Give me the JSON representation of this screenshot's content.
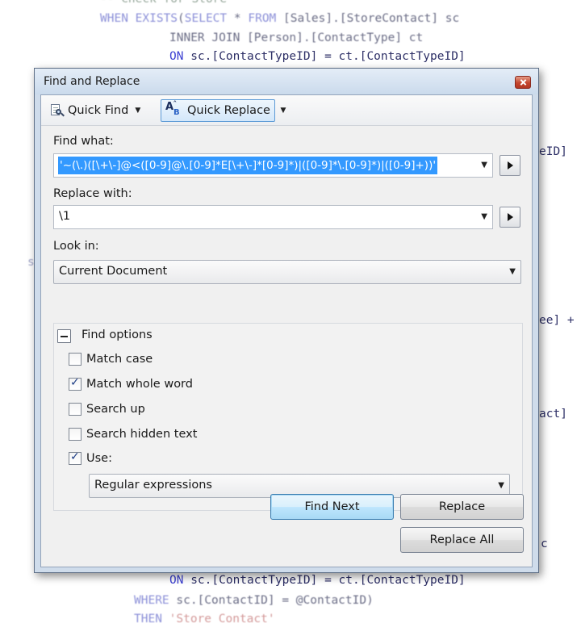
{
  "editor": {
    "lines": [
      {
        "indent": "        ",
        "parts": [
          {
            "t": "-- Check for Store",
            "c": "comment"
          }
        ],
        "faint": true
      },
      {
        "indent": "        ",
        "parts": [
          {
            "t": "WHEN EXISTS",
            "c": "kwf"
          },
          {
            "t": "(",
            "c": "grey"
          },
          {
            "t": "SELECT",
            "c": "kwf"
          },
          {
            "t": " * ",
            "c": "grey"
          },
          {
            "t": "FROM",
            "c": "kwf"
          },
          {
            "t": " [Sales].[StoreContact] sc",
            "c": "grey"
          }
        ],
        "faint": true
      },
      {
        "indent": "              ",
        "parts": [
          {
            "t": "INNER JOIN [Person].[ContactType] ct",
            "c": "grey"
          }
        ],
        "faint": false
      },
      {
        "indent": "              ",
        "parts": [
          {
            "t": "ON",
            "c": "kw"
          },
          {
            "t": " sc.[ContactTypeID] = ct.[ContactTypeID]",
            "c": ""
          }
        ],
        "faint": false
      },
      {
        "indent": "              ",
        "parts": [
          {
            "t": "ON",
            "c": "kw"
          },
          {
            "t": " sc.[ContactTypeID] = ct.[ContactTypeID]",
            "c": ""
          }
        ],
        "faint": false
      },
      {
        "indent": "           ",
        "parts": [
          {
            "t": "WHERE",
            "c": "kwf"
          },
          {
            "t": " sc.[ContactID] = @ContactID)",
            "c": "grey"
          }
        ],
        "faint": true
      },
      {
        "indent": "           ",
        "parts": [
          {
            "t": "THEN",
            "c": "kwf"
          },
          {
            "t": " 'Store Contact'",
            "c": "str"
          }
        ],
        "faint": true
      }
    ],
    "edge_fragments": [
      "eID]",
      "ee] +",
      "act]",
      "c",
      "s"
    ]
  },
  "dialog": {
    "title": "Find and Replace",
    "toolbar": {
      "quick_find": "Quick Find",
      "quick_replace": "Quick Replace"
    },
    "find_label": "Find what:",
    "find_value": "'~(\\.)([\\+\\-]@<([0-9]@\\.[0-9]*E[\\+\\-]*[0-9]*)|([0-9]*\\.[0-9]*)|([0-9]+))'",
    "replace_label": "Replace with:",
    "replace_value": "\\1",
    "look_in_label": "Look in:",
    "look_in_value": "Current Document",
    "options": {
      "title": "Find options",
      "match_case": "Match case",
      "match_whole_word": "Match whole word",
      "search_up": "Search up",
      "search_hidden_text": "Search hidden text",
      "use": "Use:",
      "use_value": "Regular expressions"
    },
    "buttons": {
      "find_next": "Find Next",
      "replace": "Replace",
      "replace_all": "Replace All"
    }
  }
}
